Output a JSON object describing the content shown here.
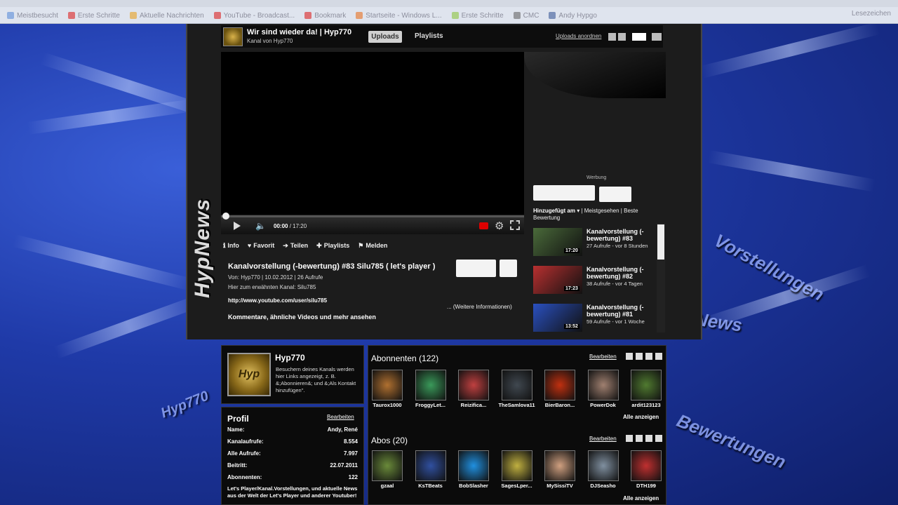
{
  "browser": {
    "bookmarks": [
      {
        "label": "Meistbesucht",
        "icon": "globe-icon",
        "color": "#5b8dd9"
      },
      {
        "label": "Erste Schritte",
        "icon": "youtube-icon",
        "color": "#d22"
      },
      {
        "label": "Aktuelle Nachrichten",
        "icon": "rss-icon",
        "color": "#e8a020"
      },
      {
        "label": "YouTube - Broadcast...",
        "icon": "youtube-icon",
        "color": "#d22"
      },
      {
        "label": "Bookmark",
        "icon": "opera-icon",
        "color": "#d22"
      },
      {
        "label": "Startseite - Windows L...",
        "icon": "windows-icon",
        "color": "#e87020"
      },
      {
        "label": "Erste Schritte",
        "icon": "yahoo-icon",
        "color": "#8cc63f"
      },
      {
        "label": "CMC",
        "icon": "cmc-icon",
        "color": "#666"
      },
      {
        "label": "Andy Hypgo",
        "icon": "facebook-icon",
        "color": "#3b5998"
      }
    ],
    "other_bookmarks": "Lesezeichen"
  },
  "background": {
    "texts": [
      "Vorstellungen",
      "News",
      "Bewertungen",
      "Hyp770"
    ]
  },
  "sideband_label": "HypNews",
  "channel": {
    "title": "Wir sind wieder da! | Hyp770",
    "by": "Kanal von Hyp770",
    "tab_uploads": "Uploads",
    "tab_playlists": "Playlists",
    "arrange": "Uploads anordnen"
  },
  "player": {
    "current_time": "00:00",
    "duration": "/ 17:20"
  },
  "tabs": [
    {
      "icon": "info-icon",
      "glyph": "ℹ",
      "label": "Info"
    },
    {
      "icon": "heart-icon",
      "glyph": "♥",
      "label": "Favorit"
    },
    {
      "icon": "share-icon",
      "glyph": "➔",
      "label": "Teilen"
    },
    {
      "icon": "plus-icon",
      "glyph": "✚",
      "label": "Playlists"
    },
    {
      "icon": "flag-icon",
      "glyph": "⚑",
      "label": "Melden"
    }
  ],
  "video": {
    "title": "Kanalvorstellung (-bewertung) #83 Silu785 ( let's player )",
    "meta": "Von: Hyp770  |  10.02.2012  |  26 Aufrufe",
    "desc": "Hier zum erwähnten Kanal: Silu785",
    "link": "http://www.youtube.com/user/silu785",
    "more_info": "... (Weitere Informationen)",
    "comments": "Kommentare, ähnliche Videos und mehr ansehen"
  },
  "sidebar": {
    "ad_label": "Werbung",
    "sort_prefix": "Hinzugefügt am",
    "sort_rest": "| Meistgesehen | Beste Bewertung",
    "related": [
      {
        "title": "Kanalvorstellung (-bewertung) #83",
        "stats": "27 Aufrufe - vor 8 Stunden",
        "duration": "17:20",
        "thumb": "#4a6a3a"
      },
      {
        "title": "Kanalvorstellung (-bewertung) #82",
        "stats": "38 Aufrufe - vor 4 Tagen",
        "duration": "17:23",
        "thumb": "#b83030"
      },
      {
        "title": "Kanalvorstellung (-bewertung) #81",
        "stats": "59 Aufrufe - vor 1 Woche",
        "duration": "13:52",
        "thumb": "#2a50c0"
      }
    ]
  },
  "profile_card": {
    "name": "Hyp770",
    "avatar_text": "Hyp",
    "welcome": "Besuchern deines Kanals werden hier Links angezeigt, z. B. &;Abonnieren&; und &;Als Kontakt hinzufügen\"."
  },
  "profile": {
    "title": "Profil",
    "edit": "Bearbeiten",
    "rows": [
      {
        "label": "Name:",
        "value": "Andy, René"
      },
      {
        "label": "Kanalaufrufe:",
        "value": "8.554"
      },
      {
        "label": "Alle Aufrufe:",
        "value": "7.997"
      },
      {
        "label": "Beitritt:",
        "value": "22.07.2011"
      },
      {
        "label": "Abonnenten:",
        "value": "122"
      }
    ],
    "bio": "Let's Player/Kanal.Vorstellungen, und aktuelle News aus der Welt der Let's Player und anderer Youtuber!"
  },
  "subscribers": {
    "title": "Abonnenten (122)",
    "edit": "Bearbeiten",
    "show_all": "Alle anzeigen",
    "items": [
      {
        "name": "Taurox1000",
        "color": "#b07030"
      },
      {
        "name": "FroggyLet...",
        "color": "#3a9a5a"
      },
      {
        "name": "Reizifica...",
        "color": "#c04040"
      },
      {
        "name": "TheSamlova11",
        "color": "#404850"
      },
      {
        "name": "BierBaron...",
        "color": "#c03010"
      },
      {
        "name": "PowerDok",
        "color": "#a08070"
      },
      {
        "name": "ardit123123",
        "color": "#507a30"
      }
    ]
  },
  "subscriptions": {
    "title": "Abos (20)",
    "edit": "Bearbeiten",
    "show_all": "Alle anzeigen",
    "items": [
      {
        "name": "gzaal",
        "color": "#6a8a3a"
      },
      {
        "name": "KsTBeats",
        "color": "#3050a0"
      },
      {
        "name": "BobSlasher",
        "color": "#2090e0"
      },
      {
        "name": "SagesLper...",
        "color": "#c0b040"
      },
      {
        "name": "MySissiTV",
        "color": "#d0a080"
      },
      {
        "name": "DJSeasho",
        "color": "#8090a0"
      },
      {
        "name": "DTH199",
        "color": "#c03030"
      }
    ]
  }
}
